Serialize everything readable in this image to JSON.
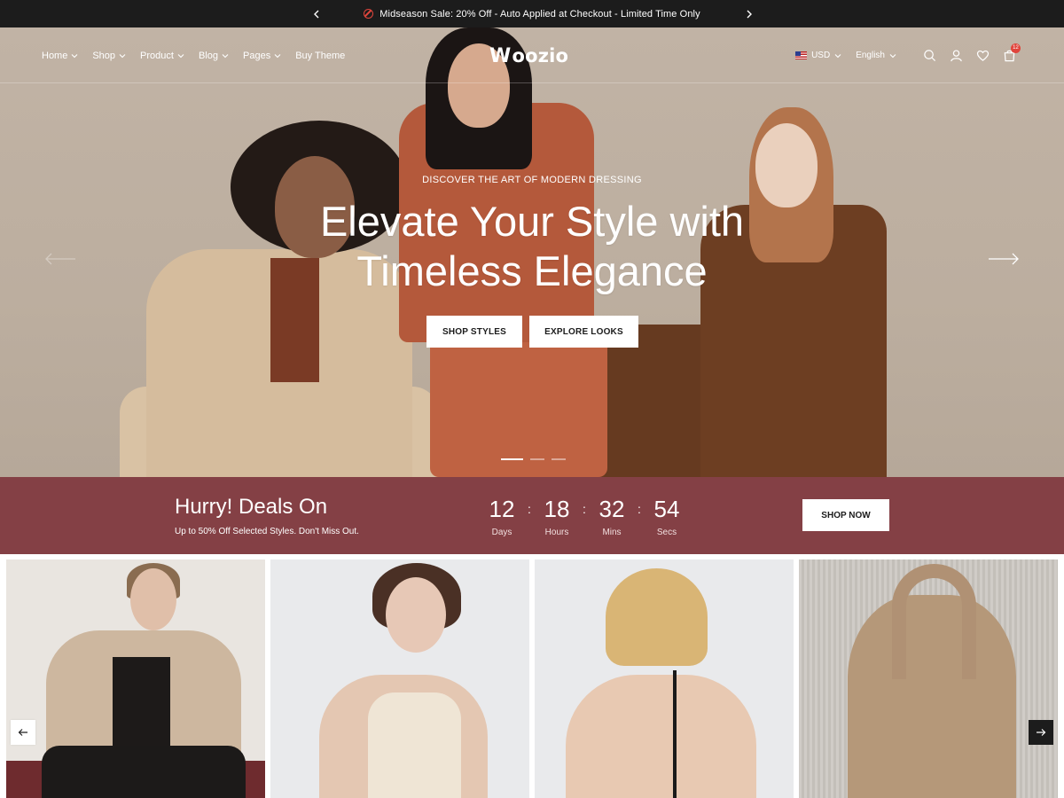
{
  "announcement": {
    "message": "Midseason Sale: 20% Off - Auto Applied at Checkout - Limited Time Only",
    "prev_icon": "chevron-left-icon",
    "next_icon": "chevron-right-icon"
  },
  "header": {
    "nav": [
      {
        "label": "Home",
        "has_dropdown": true
      },
      {
        "label": "Shop",
        "has_dropdown": true
      },
      {
        "label": "Product",
        "has_dropdown": true
      },
      {
        "label": "Blog",
        "has_dropdown": true
      },
      {
        "label": "Pages",
        "has_dropdown": true
      },
      {
        "label": "Buy Theme",
        "has_dropdown": false
      }
    ],
    "logo": "oozio",
    "logo_mark": "W",
    "currency": "USD",
    "language": "English",
    "cart_count": "12",
    "icons": [
      "search-icon",
      "user-icon",
      "heart-icon",
      "cart-icon"
    ]
  },
  "hero": {
    "eyebrow": "DISCOVER THE ART OF MODERN DRESSING",
    "headline_line1": "Elevate Your Style with",
    "headline_line2": "Timeless Elegance",
    "buttons": {
      "primary": "SHOP STYLES",
      "secondary": "EXPLORE LOOKS"
    },
    "slides_total": 3,
    "active_slide": 1
  },
  "deals": {
    "title": "Hurry! Deals On",
    "subtitle": "Up to 50% Off Selected Styles. Don't Miss Out.",
    "countdown": [
      {
        "value": "12",
        "label": "Days"
      },
      {
        "value": "18",
        "label": "Hours"
      },
      {
        "value": "32",
        "label": "Mins"
      },
      {
        "value": "54",
        "label": "Secs"
      }
    ],
    "cta": "SHOP NOW"
  },
  "colors": {
    "announce_bg": "#1c1c1c",
    "hero_bg": "#bfb1a2",
    "deals_bg": "#844045",
    "sale_icon": "#e0453c"
  }
}
